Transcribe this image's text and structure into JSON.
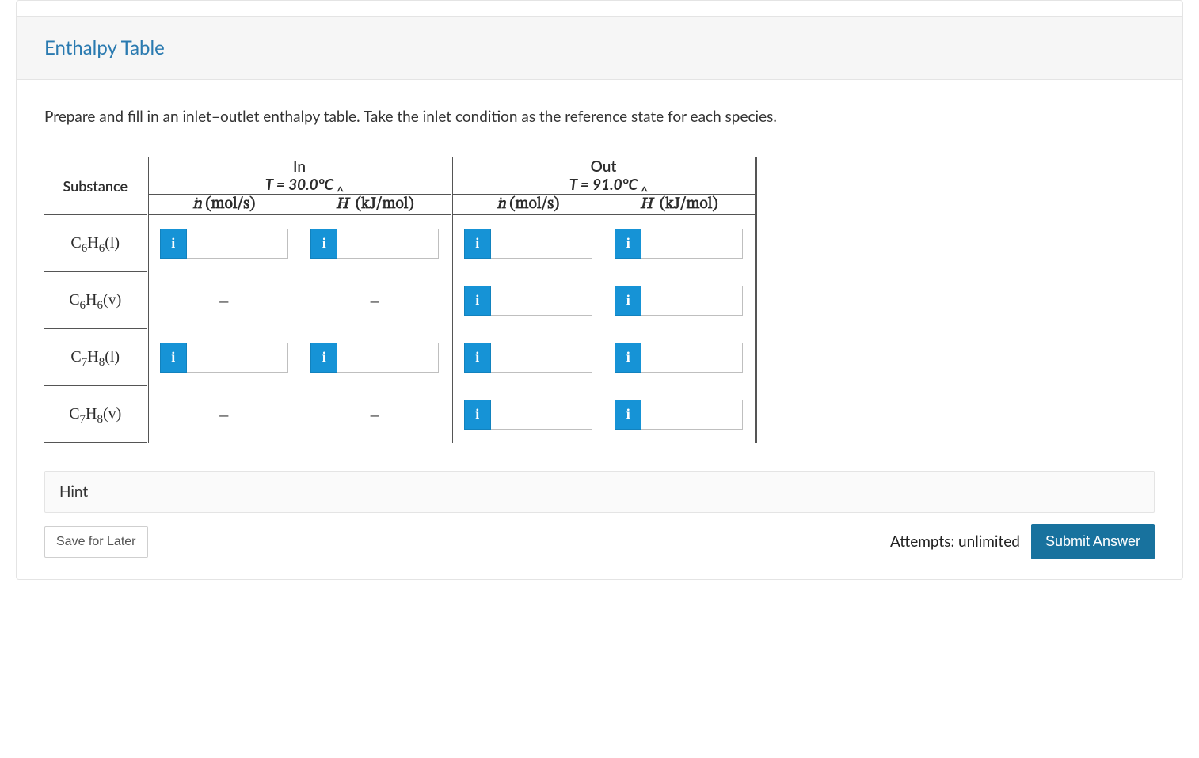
{
  "section": {
    "title": "Enthalpy Table"
  },
  "instruction": "Prepare and fill in an inlet–outlet enthalpy table. Take the inlet condition as the reference state for each species.",
  "table": {
    "substance_header": "Substance",
    "groups": {
      "in": {
        "title": "In",
        "temp": "T = 30.0°C"
      },
      "out": {
        "title": "Out",
        "temp": "T = 91.0°C"
      }
    },
    "col_labels": {
      "ndot_units": "(mol/s)",
      "hhat_units": "(kJ/mol)"
    },
    "rows": [
      {
        "substance_html": "C<sub>6</sub>H<sub>6</sub>(l)",
        "in_n": "input",
        "in_h": "input",
        "out_n": "input",
        "out_h": "input"
      },
      {
        "substance_html": "C<sub>6</sub>H<sub>6</sub>(v)",
        "in_n": "dash",
        "in_h": "dash",
        "out_n": "input",
        "out_h": "input"
      },
      {
        "substance_html": "C<sub>7</sub>H<sub>8</sub>(l)",
        "in_n": "input",
        "in_h": "input",
        "out_n": "input",
        "out_h": "input"
      },
      {
        "substance_html": "C<sub>7</sub>H<sub>8</sub>(v)",
        "in_n": "dash",
        "in_h": "dash",
        "out_n": "input",
        "out_h": "input"
      }
    ],
    "dash_glyph": "–"
  },
  "hint": {
    "label": "Hint"
  },
  "actions": {
    "save": "Save for Later",
    "attempts": "Attempts: unlimited",
    "submit": "Submit Answer"
  },
  "info_glyph": "i"
}
